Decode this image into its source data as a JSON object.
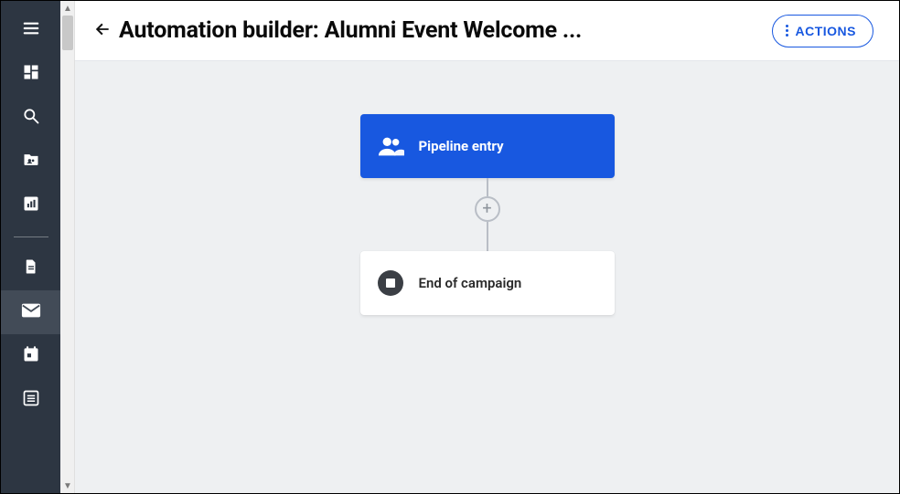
{
  "header": {
    "title": "Automation builder: Alumni Event Welcome ...",
    "actions_label": "ACTIONS"
  },
  "flow": {
    "entry_label": "Pipeline entry",
    "end_label": "End of campaign",
    "add_step_symbol": "+"
  },
  "sidebar": {
    "items": [
      {
        "name": "menu"
      },
      {
        "name": "dashboard"
      },
      {
        "name": "search"
      },
      {
        "name": "contacts-folder"
      },
      {
        "name": "analytics"
      },
      {
        "name": "document"
      },
      {
        "name": "email",
        "active": true
      },
      {
        "name": "calendar"
      },
      {
        "name": "list"
      }
    ]
  }
}
